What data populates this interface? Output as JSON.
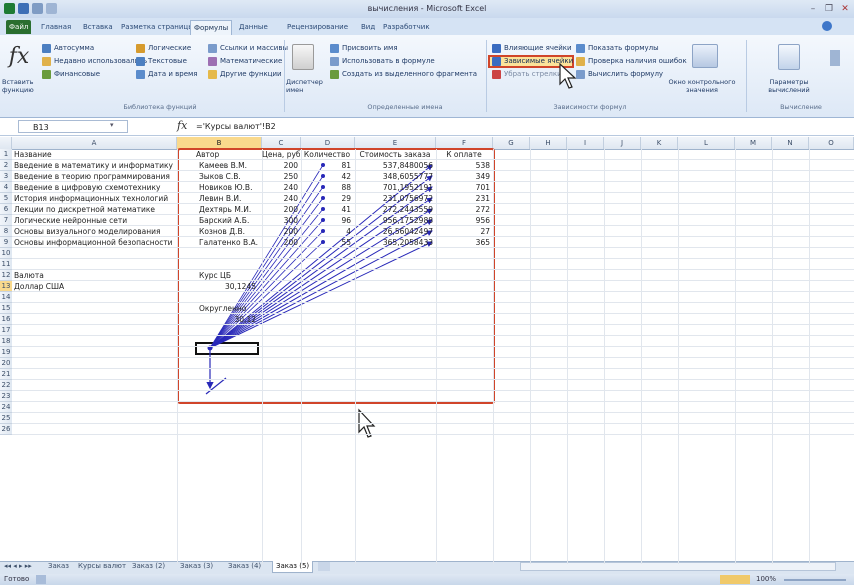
{
  "window": {
    "title": "вычисления - Microsoft Excel"
  },
  "ribbon_tabs": [
    "Файл",
    "Главная",
    "Вставка",
    "Разметка страницы",
    "Формулы",
    "Данные",
    "Рецензирование",
    "Вид",
    "Разработчик"
  ],
  "ribbon": {
    "insert_function": "Вставить функцию",
    "function_library": {
      "autosum": "Автосумма",
      "recent": "Недавно использовались",
      "financial": "Финансовые",
      "logical": "Логические",
      "text": "Текстовые",
      "datetime": "Дата и время",
      "lookup": "Ссылки и массивы",
      "math": "Математические",
      "more": "Другие функции",
      "group_label": "Библиотека функций"
    },
    "defined_names": {
      "name_manager": "Диспетчер имен",
      "define_name": "Присвоить имя",
      "use_in_formula": "Использовать в формуле",
      "create_from_selection": "Создать из выделенного фрагмента",
      "group_label": "Определенные имена"
    },
    "formula_auditing": {
      "trace_precedents": "Влияющие ячейки",
      "trace_dependents": "Зависимые ячейки",
      "remove_arrows": "Убрать стрелки",
      "show_formulas": "Показать формулы",
      "error_checking": "Проверка наличия ошибок",
      "evaluate_formula": "Вычислить формулу",
      "watch_window": "Окно контрольного значения",
      "group_label": "Зависимости формул"
    },
    "calculation": {
      "options": "Параметры вычислений",
      "group_label": "Вычисление"
    }
  },
  "formula_bar": {
    "name_box": "B13",
    "fx": "fx",
    "formula": "='Курсы валют'!B2"
  },
  "columns": [
    "A",
    "B",
    "C",
    "D",
    "E",
    "F",
    "G",
    "H",
    "I",
    "J",
    "K",
    "L",
    "M",
    "N",
    "O"
  ],
  "row_numbers": [
    "1",
    "2",
    "3",
    "4",
    "5",
    "6",
    "7",
    "8",
    "9",
    "10",
    "11",
    "12",
    "13",
    "14",
    "15",
    "16",
    "17",
    "18",
    "19",
    "20",
    "21",
    "22",
    "23",
    "24",
    "25",
    "26"
  ],
  "table": {
    "headers": [
      "Название",
      "Автор",
      "Цена, руб.",
      "Количество",
      "Стоимость заказа",
      "К оплате"
    ],
    "rows": [
      [
        "Введение в математику и информатику",
        "Камеев В.М.",
        "200",
        "81",
        "537,8480056",
        "538"
      ],
      [
        "Введение в теорию программирования",
        "Зыков С.В.",
        "250",
        "42",
        "348,6055777",
        "349"
      ],
      [
        "Введение в цифровую схемотехнику",
        "Новиков Ю.В.",
        "240",
        "88",
        "701,1952191",
        "701"
      ],
      [
        "История информационных технологий",
        "Левин В.И.",
        "240",
        "29",
        "231,0756972",
        "231"
      ],
      [
        "Лекции по дискретной математике",
        "Дехтярь М.И.",
        "200",
        "41",
        "272,2443559",
        "272"
      ],
      [
        "Логические нейронные сети",
        "Барский А.Б.",
        "300",
        "96",
        "956,1752988",
        "956"
      ],
      [
        "Основы визуального моделирования",
        "Кознов Д.В.",
        "200",
        "4",
        "26,56042497",
        "27"
      ],
      [
        "Основы информационной безопасности",
        "Галатенко В.А.",
        "200",
        "55",
        "365,2058433",
        "365"
      ]
    ]
  },
  "currency": {
    "label_a12": "Валюта",
    "label_b12": "Курс ЦБ",
    "label_a13": "Доллар США",
    "value_b13": "30,1245",
    "label_b15": "Округленно",
    "value_b16": "30,12"
  },
  "sheet_tabs": [
    "Заказ",
    "Курсы валют",
    "Заказ (2)",
    "Заказ (3)",
    "Заказ (4)",
    "Заказ (5)"
  ],
  "active_sheet_index": 5,
  "status": {
    "ready": "Готово",
    "zoom": "100%"
  },
  "colors": {
    "highlight_red": "#d0452a",
    "arrow_blue": "#2828b8",
    "selected_header": "#f9d98d",
    "file_tab": "#2a6e2f"
  }
}
